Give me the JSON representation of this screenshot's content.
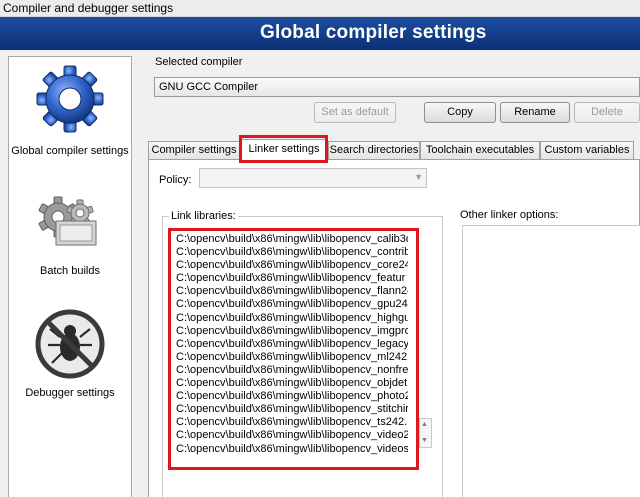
{
  "window": {
    "title": "Compiler and debugger settings"
  },
  "banner": {
    "title": "Global compiler settings"
  },
  "sidebar": {
    "items": [
      {
        "label": "Global compiler settings",
        "icon": "gear-icon"
      },
      {
        "label": "Batch builds",
        "icon": "batch-gears-icon"
      },
      {
        "label": "Debugger settings",
        "icon": "debugger-bug-icon"
      }
    ]
  },
  "compiler": {
    "label": "Selected compiler",
    "selected": "GNU GCC Compiler",
    "buttons": {
      "set_default": "Set as default",
      "copy": "Copy",
      "rename": "Rename",
      "delete": "Delete"
    }
  },
  "tabs": [
    {
      "label": "Compiler settings"
    },
    {
      "label": "Linker settings"
    },
    {
      "label": "Search directories"
    },
    {
      "label": "Toolchain executables"
    },
    {
      "label": "Custom variables"
    }
  ],
  "active_tab": "Linker settings",
  "linker": {
    "policy_label": "Policy:",
    "policy_value": "",
    "link_libraries_label": "Link libraries:",
    "other_options_label": "Other linker options:",
    "libraries": [
      "C:\\opencv\\build\\x86\\mingw\\lib\\libopencv_calib3d",
      "C:\\opencv\\build\\x86\\mingw\\lib\\libopencv_contrib",
      "C:\\opencv\\build\\x86\\mingw\\lib\\libopencv_core24",
      "C:\\opencv\\build\\x86\\mingw\\lib\\libopencv_featur",
      "C:\\opencv\\build\\x86\\mingw\\lib\\libopencv_flann24",
      "C:\\opencv\\build\\x86\\mingw\\lib\\libopencv_gpu24",
      "C:\\opencv\\build\\x86\\mingw\\lib\\libopencv_highgu",
      "C:\\opencv\\build\\x86\\mingw\\lib\\libopencv_imgpro",
      "C:\\opencv\\build\\x86\\mingw\\lib\\libopencv_legacy",
      "C:\\opencv\\build\\x86\\mingw\\lib\\libopencv_ml242.",
      "C:\\opencv\\build\\x86\\mingw\\lib\\libopencv_nonfre",
      "C:\\opencv\\build\\x86\\mingw\\lib\\libopencv_objdet",
      "C:\\opencv\\build\\x86\\mingw\\lib\\libopencv_photo2",
      "C:\\opencv\\build\\x86\\mingw\\lib\\libopencv_stitchir",
      "C:\\opencv\\build\\x86\\mingw\\lib\\libopencv_ts242.",
      "C:\\opencv\\build\\x86\\mingw\\lib\\libopencv_video2",
      "C:\\opencv\\build\\x86\\mingw\\lib\\libopencv_videos"
    ]
  },
  "colors": {
    "banner": "#0b2f74",
    "highlight": "#e0161f"
  }
}
